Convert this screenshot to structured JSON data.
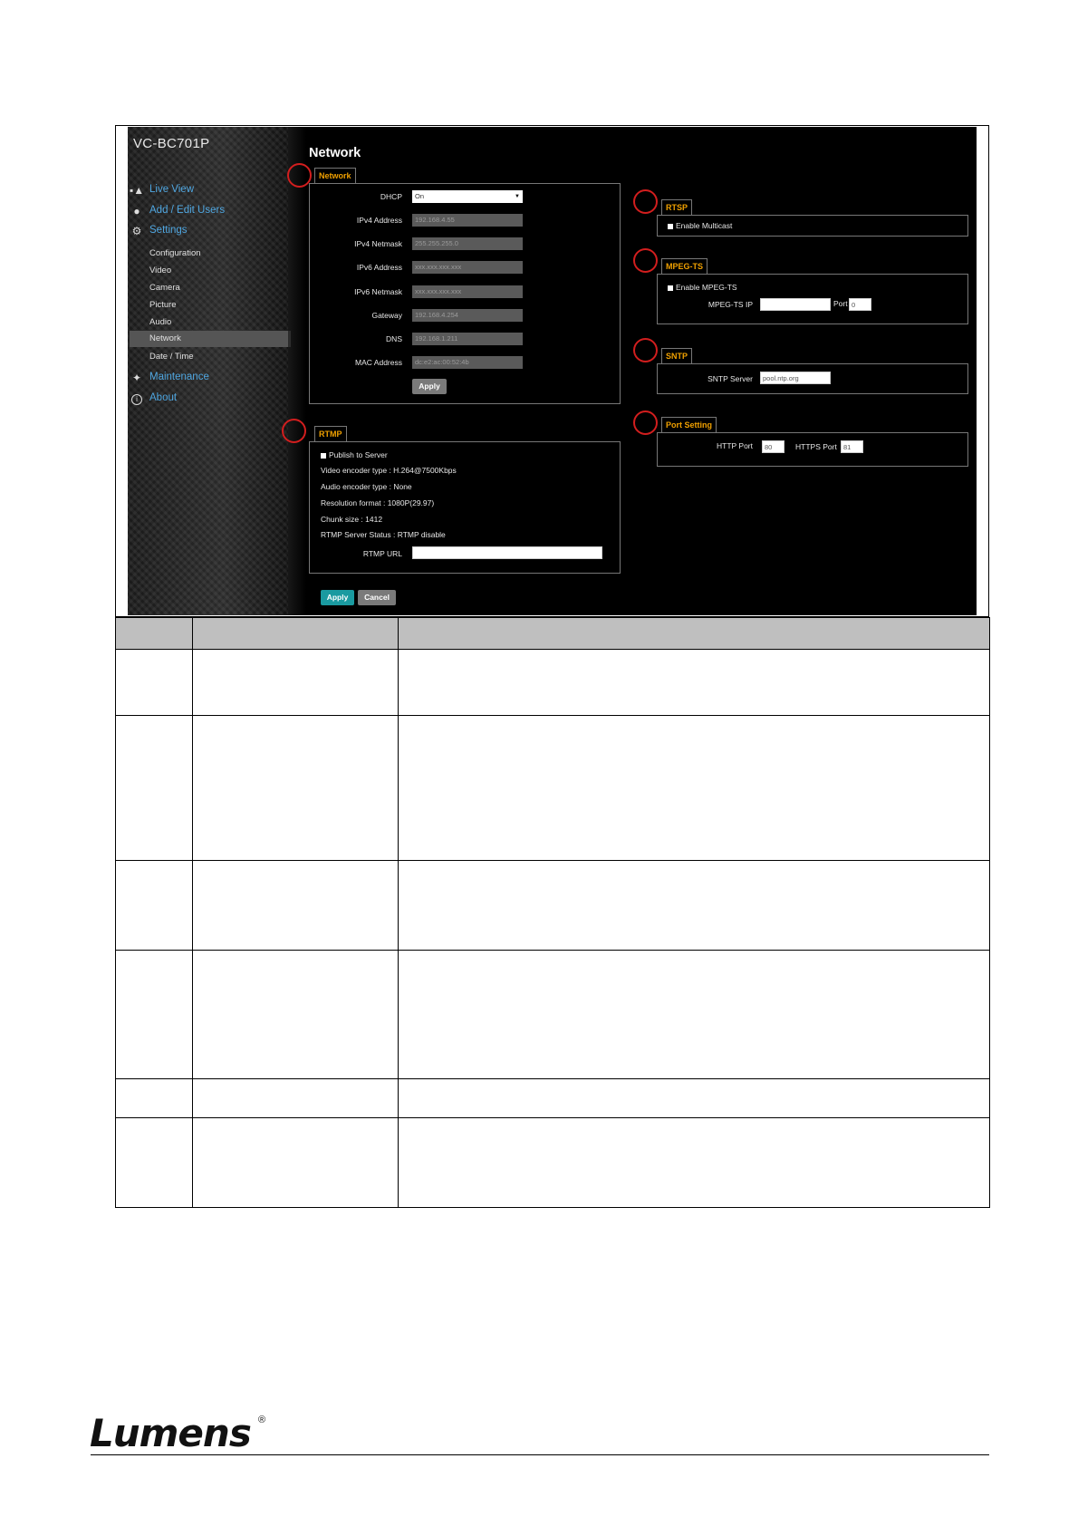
{
  "screenshot": {
    "model": "VC-BC701P",
    "page_title": "Network",
    "nav": {
      "live_view": "Live View",
      "add_edit_users": "Add / Edit Users",
      "settings": "Settings",
      "settings_items": [
        "Configuration",
        "Video",
        "Camera",
        "Picture",
        "Audio",
        "Network",
        "Date / Time"
      ],
      "active_item": "Network",
      "maintenance": "Maintenance",
      "about": "About"
    },
    "network": {
      "tab": "Network",
      "dhcp_label": "DHCP",
      "dhcp_value": "On",
      "ipv4_address_label": "IPv4 Address",
      "ipv4_address_value": "192.168.4.55",
      "ipv4_netmask_label": "IPv4 Netmask",
      "ipv4_netmask_value": "255.255.255.0",
      "ipv6_address_label": "IPv6 Address",
      "ipv6_address_value": "xxx.xxx.xxx.xxx",
      "ipv6_netmask_label": "IPv6 Netmask",
      "ipv6_netmask_value": "xxx.xxx.xxx.xxx",
      "gateway_label": "Gateway",
      "gateway_value": "192.168.4.254",
      "dns_label": "DNS",
      "dns_value": "192.168.1.211",
      "mac_label": "MAC Address",
      "mac_value": "dc:e2:ac:00:52:4b",
      "apply": "Apply"
    },
    "rtmp": {
      "tab": "RTMP",
      "publish": "Publish to Server",
      "video_encoder": "Video encoder type : H.264@7500Kbps",
      "audio_encoder": "Audio encoder type : None",
      "resolution": "Resolution format : 1080P(29.97)",
      "chunk": "Chunk size : 1412",
      "server_status": "RTMP Server Status : RTMP disable",
      "url_label": "RTMP URL",
      "url_value": ""
    },
    "rtsp": {
      "tab": "RTSP",
      "multicast": "Enable Multicast"
    },
    "mpegts": {
      "tab": "MPEG-TS",
      "enable": "Enable MPEG-TS",
      "ip_label": "MPEG-TS IP",
      "ip_value": "",
      "port_label": "Port",
      "port_value": "0"
    },
    "sntp": {
      "tab": "SNTP",
      "server_label": "SNTP Server",
      "server_value": "pool.ntp.org"
    },
    "port_setting": {
      "tab": "Port Setting",
      "http_label": "HTTP Port",
      "http_value": "80",
      "https_label": "HTTPS Port",
      "https_value": "81"
    },
    "bottom_apply": "Apply",
    "bottom_cancel": "Cancel"
  },
  "brand": {
    "logo": "Lumens",
    "registered": "®"
  },
  "colors": {
    "accent_tab": "#f0a000",
    "nav_link": "#4fa6e0",
    "apply_teal": "#1a9aa0",
    "callout_red": "#d21e1e",
    "table_header": "#bfbfbf"
  }
}
